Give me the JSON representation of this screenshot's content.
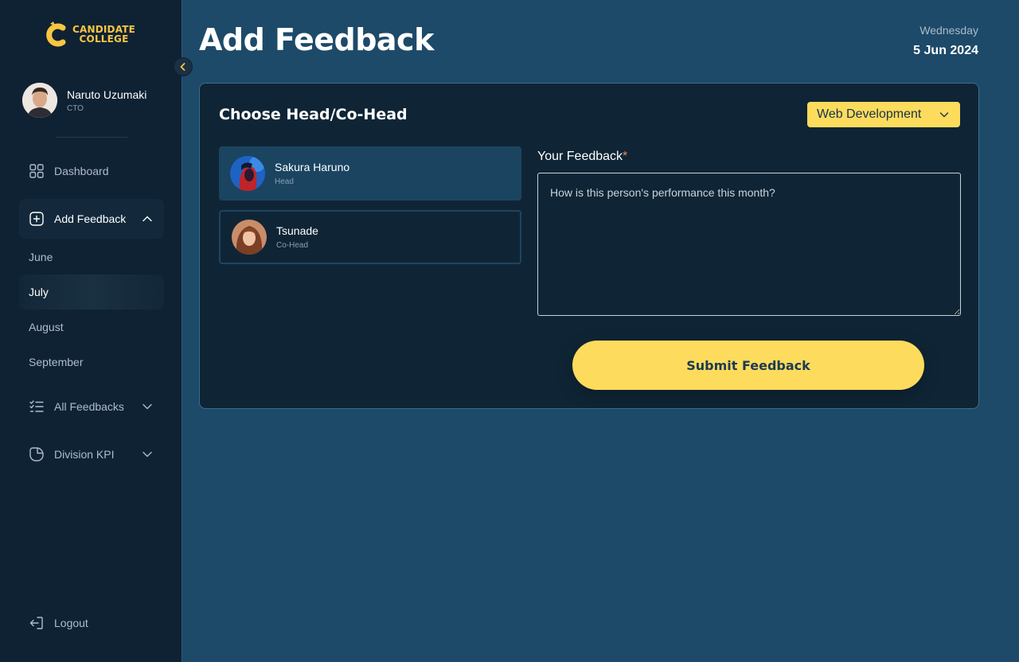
{
  "brand": {
    "line1": "CANDIDATE",
    "line2": "COLLEGE",
    "color": "#f9c642"
  },
  "user": {
    "name": "Naruto Uzumaki",
    "role": "CTO"
  },
  "nav": {
    "dashboard": {
      "label": "Dashboard",
      "icon": "grid-icon"
    },
    "add_feedback": {
      "label": "Add Feedback",
      "icon": "plus-square-icon",
      "expanded": true,
      "months": [
        "June",
        "July",
        "August",
        "September"
      ],
      "active_month": "July"
    },
    "all_feedbacks": {
      "label": "All Feedbacks",
      "icon": "checklist-icon"
    },
    "division_kpi": {
      "label": "Division KPI",
      "icon": "pie-chart-icon"
    },
    "logout": {
      "label": "Logout",
      "icon": "logout-icon"
    }
  },
  "header": {
    "title": "Add Feedback",
    "weekday": "Wednesday",
    "date": "5 Jun 2024"
  },
  "card": {
    "title": "Choose Head/Co-Head",
    "division": {
      "selected": "Web Development"
    },
    "people": [
      {
        "name": "Sakura Haruno",
        "role": "Head",
        "selected": true
      },
      {
        "name": "Tsunade",
        "role": "Co-Head",
        "selected": false
      }
    ],
    "feedback_label": "Your Feedback",
    "required_mark": "*",
    "feedback_placeholder": "How is this person's performance this month?",
    "feedback_value": "",
    "submit_label": "Submit Feedback"
  },
  "colors": {
    "accent": "#fddb5c",
    "sidebar_bg": "#0f2233",
    "main_bg": "#1d4a69",
    "card_bg": "#0f2535"
  }
}
